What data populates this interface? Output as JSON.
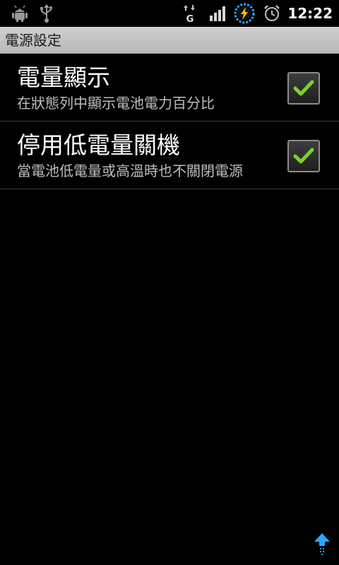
{
  "status_bar": {
    "time": "12:22",
    "network_type": "G",
    "icons": [
      "android-debug-icon",
      "usb-icon",
      "data-transfer-icon",
      "signal-icon",
      "battery-charging-icon",
      "alarm-icon"
    ]
  },
  "header": {
    "title": "電源設定"
  },
  "preferences": [
    {
      "title": "電量顯示",
      "summary": "在狀態列中顯示電池電力百分比",
      "checked": true
    },
    {
      "title": "停用低電量關機",
      "summary": "當電池低電量或高溫時也不關閉電源",
      "checked": true
    }
  ],
  "colors": {
    "checkmark": "#7bd12a",
    "title_bar": "#c4c4c4",
    "accent_blue": "#2aa8ff"
  }
}
